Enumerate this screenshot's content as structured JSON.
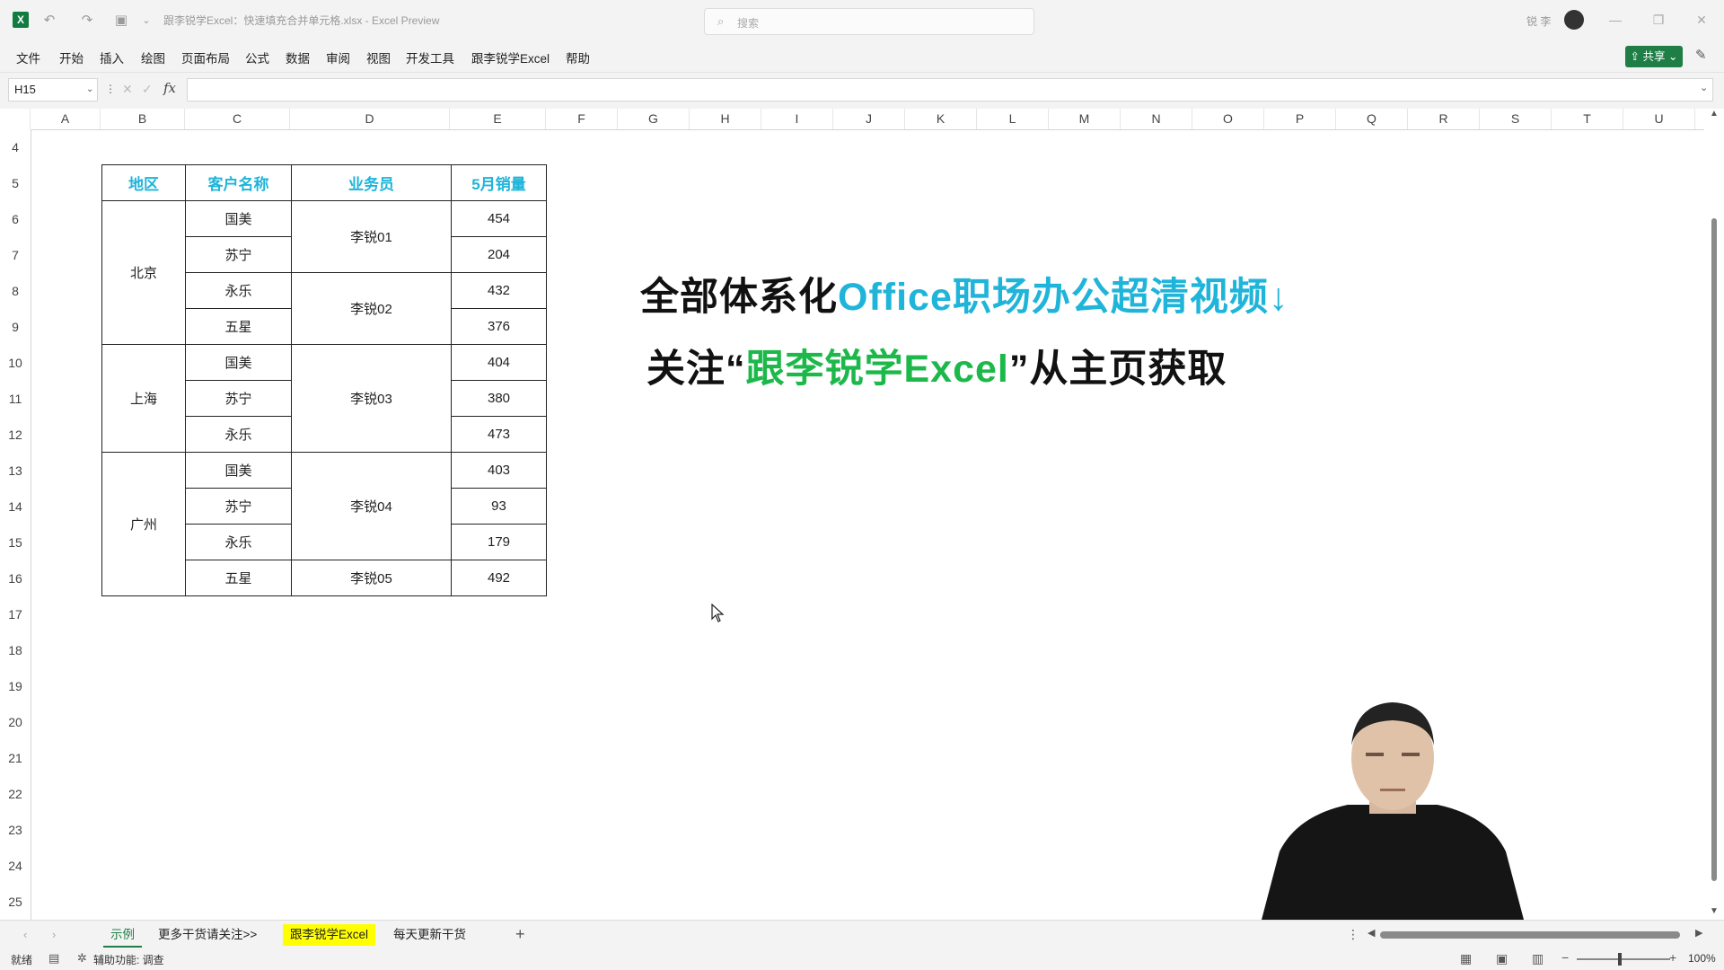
{
  "titlebar": {
    "doc_title": "跟李锐学Excel：快速填充合并单元格.xlsx  -  Excel Preview",
    "search_placeholder": "搜索",
    "user_name": "锐 李"
  },
  "menu": [
    "文件",
    "开始",
    "插入",
    "绘图",
    "页面布局",
    "公式",
    "数据",
    "审阅",
    "视图",
    "开发工具",
    "跟李锐学Excel",
    "帮助"
  ],
  "share_label": "共享",
  "formula_bar": {
    "name_box": "H15",
    "fx": "fx",
    "content": ""
  },
  "columns": [
    "A",
    "B",
    "C",
    "D",
    "E",
    "F",
    "G",
    "H",
    "I",
    "J",
    "K",
    "L",
    "M",
    "N",
    "O",
    "P",
    "Q",
    "R",
    "S",
    "T",
    "U"
  ],
  "rows": [
    "4",
    "5",
    "6",
    "7",
    "8",
    "9",
    "10",
    "11",
    "12",
    "13",
    "14",
    "15",
    "16",
    "17",
    "18",
    "19",
    "20",
    "21",
    "22",
    "23",
    "24",
    "25"
  ],
  "table": {
    "headers": [
      "地区",
      "客户名称",
      "业务员",
      "5月销量"
    ],
    "regions": [
      "北京",
      "上海",
      "广州"
    ],
    "customers": [
      "国美",
      "苏宁",
      "永乐",
      "五星",
      "国美",
      "苏宁",
      "永乐",
      "国美",
      "苏宁",
      "永乐",
      "五星"
    ],
    "salespeople": [
      "李锐01",
      "李锐02",
      "李锐03",
      "李锐04",
      "李锐05"
    ],
    "sales": [
      "454",
      "204",
      "432",
      "376",
      "404",
      "380",
      "473",
      "403",
      "93",
      "179",
      "492"
    ]
  },
  "promo": {
    "line1_black": "全部体系化",
    "line1_blue": "Office职场办公超清视频↓",
    "line2_pre": "关注“",
    "line2_green": "跟李锐学Excel",
    "line2_post": "”从主页获取"
  },
  "sheets": [
    "示例",
    "更多干货请关注>>",
    "跟李锐学Excel",
    "每天更新干货"
  ],
  "status": {
    "ready": "就绪",
    "accessibility": "辅助功能: 调查",
    "zoom": "100%"
  },
  "colors": {
    "header_blue": "#1fb4d9",
    "promo_green": "#1db84a",
    "excel_green": "#1e7e45",
    "tab_highlight": "#ffff00"
  }
}
